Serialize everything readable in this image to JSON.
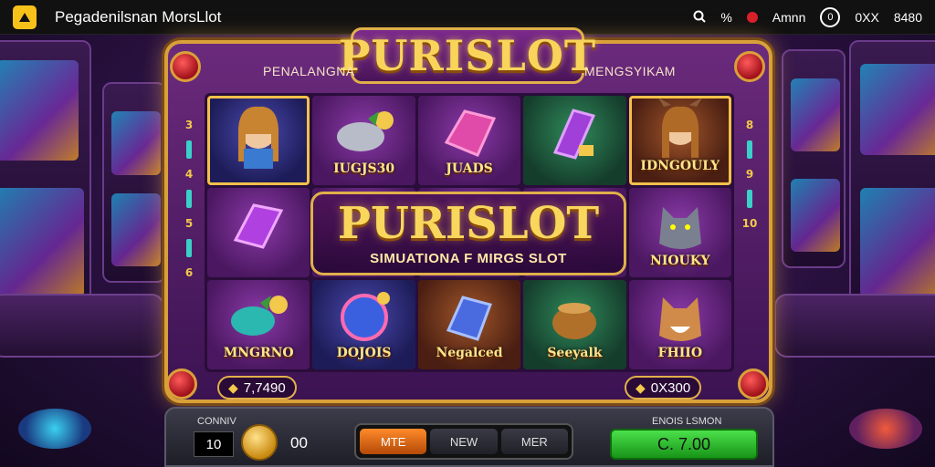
{
  "window": {
    "title": "Pegadenilsnan MorsLlot",
    "right": {
      "icons_text": "% ",
      "q_label": "Q",
      "user": "Amnn",
      "badge": "0",
      "value1": "0XX",
      "value2": "8480"
    }
  },
  "machine": {
    "brand": "PURISLOT",
    "left_label": "PENALANGNA",
    "right_label": "MENGSYIKAM",
    "banner_title": "PURISLOT",
    "banner_subtitle": "SIMUATIONA F MIRGS SLOT",
    "reels": [
      {
        "label": "",
        "kind": "portrait"
      },
      {
        "label": "IUGJS30",
        "kind": "fish"
      },
      {
        "label": "JUADS",
        "kind": "gem-pink"
      },
      {
        "label": "",
        "kind": "gem-purple"
      },
      {
        "label": "IDNGOULY",
        "kind": "portrait"
      },
      {
        "label": "",
        "kind": "gem-purple"
      },
      {
        "label": "",
        "kind": "blank"
      },
      {
        "label": "",
        "kind": "blank"
      },
      {
        "label": "",
        "kind": "blank"
      },
      {
        "label": "NIOUKY",
        "kind": "wolf"
      },
      {
        "label": "MNGRNO",
        "kind": "fish"
      },
      {
        "label": "DOJOIS",
        "kind": "gem-blue"
      },
      {
        "label": "Negalced",
        "kind": "gem-blue"
      },
      {
        "label": "Seeyalk",
        "kind": "pot"
      },
      {
        "label": "FHIIO",
        "kind": "fox"
      }
    ],
    "left_pill": "7,7490",
    "right_pill": "0X300",
    "rail_left": [
      "3",
      "4",
      "5",
      "6"
    ],
    "rail_right": [
      "8",
      "9",
      "10"
    ]
  },
  "panel": {
    "coin_label": "CONNIV",
    "coin_box": "10",
    "coin_value": "00",
    "buttons": [
      "MTE",
      "NEW",
      "MER"
    ],
    "active_index": 0,
    "right_label": "ENOIS LSMON",
    "spin_value": "C. 7.00"
  },
  "colors": {
    "gold": "#e0b04a",
    "purple": "#4a1760",
    "spin_green": "#2fbf2f",
    "accent_orange": "#ff8a2a"
  },
  "icons": [
    "app-logo-icon",
    "search-icon",
    "percent-icon",
    "record-dot-icon",
    "coin-icon"
  ]
}
